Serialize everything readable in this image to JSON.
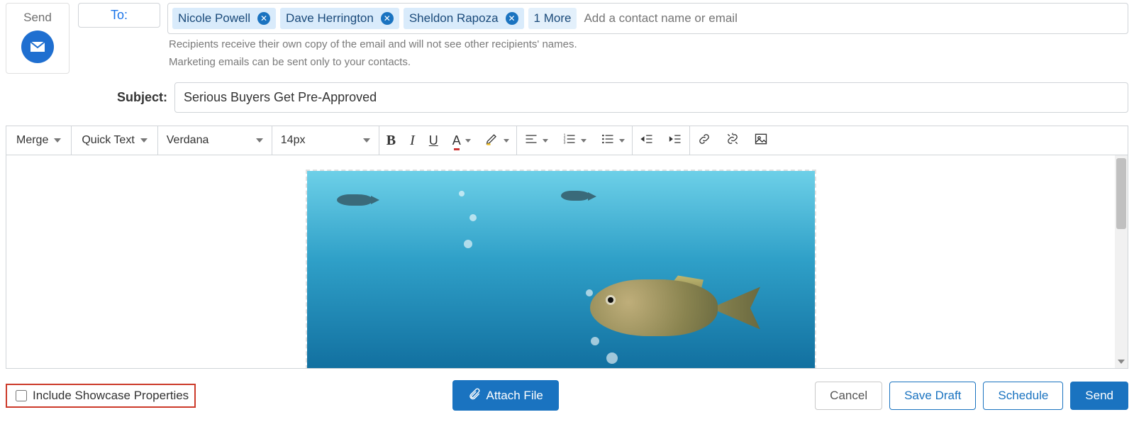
{
  "send_panel": {
    "label": "Send"
  },
  "to_button": "To:",
  "recipients": {
    "chips": [
      "Nicole Powell",
      "Dave Herrington",
      "Sheldon Rapoza"
    ],
    "more_label": "1 More",
    "input_placeholder": "Add a contact name or email"
  },
  "hints": {
    "line1": "Recipients receive their own copy of the email and will not see other recipients' names.",
    "line2": "Marketing emails can be sent only to your contacts."
  },
  "subject": {
    "label": "Subject:",
    "value": "Serious Buyers Get Pre-Approved"
  },
  "toolbar": {
    "merge": "Merge",
    "quick_text": "Quick Text",
    "font_family": "Verdana",
    "font_size": "14px",
    "bold": "B",
    "italic": "I",
    "underline": "U",
    "font_color_letter": "A"
  },
  "footer": {
    "showcase_label": "Include Showcase Properties",
    "attach": "Attach File",
    "cancel": "Cancel",
    "save_draft": "Save Draft",
    "schedule": "Schedule",
    "send": "Send"
  }
}
